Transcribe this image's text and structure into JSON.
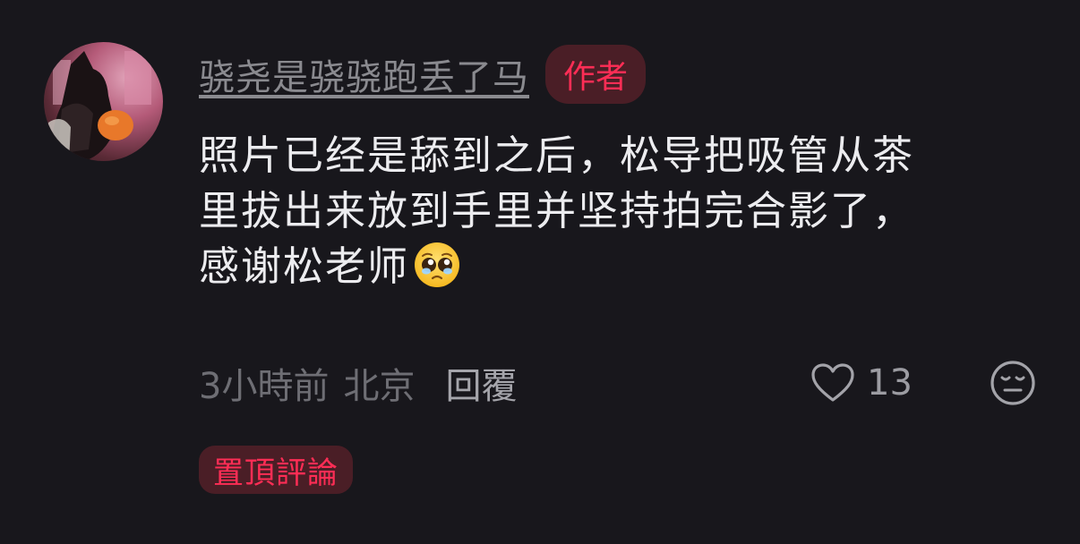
{
  "comment": {
    "username": "骁尧是骁骁跑丢了马",
    "author_badge": "作者",
    "text_lines": [
      "照片已经是舔到之后，松导把吸管从茶",
      "里拔出来放到手里并坚持拍完合影了，",
      "感谢松老师"
    ],
    "emoji": "pleading-face-icon",
    "time": "3小時前",
    "location": "北京",
    "reply_label": "回覆",
    "like_count": "13",
    "pinned_label": "置頂評論"
  },
  "colors": {
    "background": "#18171c",
    "accent": "#ff2d55",
    "badge_bg": "#4a1e26"
  }
}
